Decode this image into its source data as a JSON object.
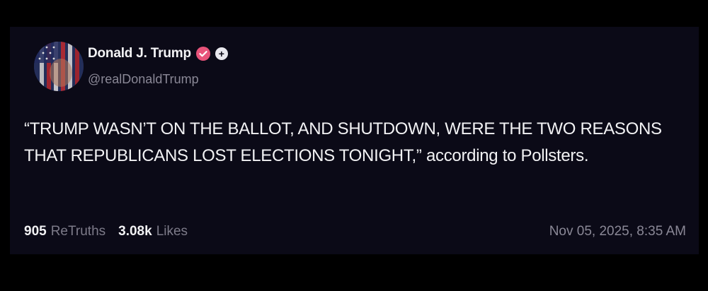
{
  "post": {
    "author_name": "Donald J. Trump",
    "handle": "@realDonaldTrump",
    "text": "“TRUMP WASN’T ON THE BALLOT, AND SHUTDOWN, WERE THE TWO REASONS THAT REPUBLICANS LOST ELECTIONS TONIGHT,” according to Pollsters.",
    "retruths_count": "905",
    "retruths_label": "ReTruths",
    "likes_count": "3.08k",
    "likes_label": "Likes",
    "timestamp": "Nov 05, 2025, 8:35 AM",
    "verified_icon": "verified-badge-icon",
    "follow_icon": "plus-icon"
  },
  "colors": {
    "background": "#000000",
    "card": "#0b0a17",
    "verified": "#e8537a",
    "text": "#f2f2f4",
    "muted": "#8a8896"
  }
}
